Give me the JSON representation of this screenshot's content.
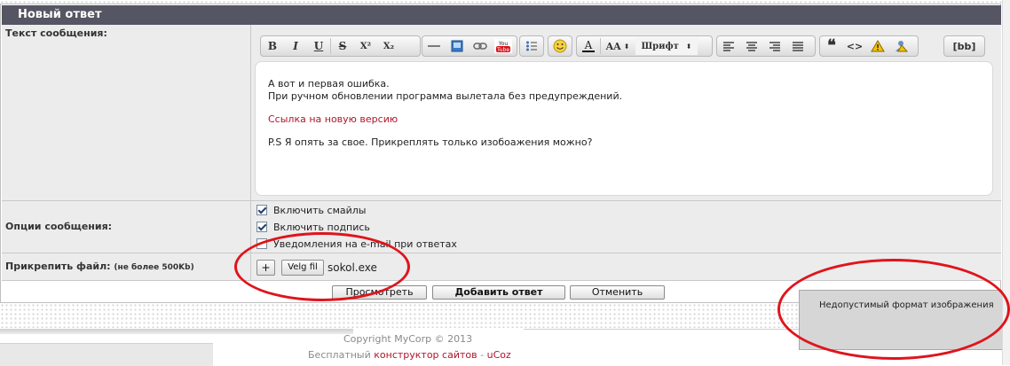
{
  "form": {
    "title": "Новый ответ",
    "message_label": "Текст сообщения:",
    "options_label": "Опции сообщения:",
    "attach_label": "Прикрепить файл:",
    "attach_note": "(не более 500Kb)"
  },
  "toolbar": {
    "bold": "B",
    "italic": "I",
    "underline": "U",
    "strike": "S",
    "superscript": "X²",
    "subscript": "X₂",
    "youtube": "You Tube",
    "font_size": "AA",
    "font_family": "Шрифт",
    "bbcode": "[bb]"
  },
  "editor": {
    "lines": [
      "А вот и первая ошибка.",
      "При ручном обновлении программа вылетала без предупреждений.",
      "Ссылка на новую версию",
      "P.S Я опять за свое. Прикреплять только изобоажения можно?"
    ]
  },
  "options": [
    {
      "label": "Включить смайлы",
      "checked": true
    },
    {
      "label": "Включить подпись",
      "checked": true
    },
    {
      "label": "Уведомления на e-mail при ответах",
      "checked": false
    }
  ],
  "attach": {
    "add_label": "+",
    "choose_label": "Velg fil",
    "filename": "sokol.exe"
  },
  "actions": {
    "preview": "Просмотреть",
    "submit": "Добавить ответ",
    "cancel": "Отменить"
  },
  "footer": {
    "copyright": "Copyright MyCorp © 2013",
    "builder_prefix": "Бесплатный",
    "builder_link": "конструктор сайтов",
    "builder_sep": "-",
    "builder_brand": "uCoz"
  },
  "popup": {
    "message": "Недопустимый формат изображения"
  },
  "colors": {
    "header": "#565563",
    "link": "#b0152a",
    "annotation": "#e0141c"
  }
}
